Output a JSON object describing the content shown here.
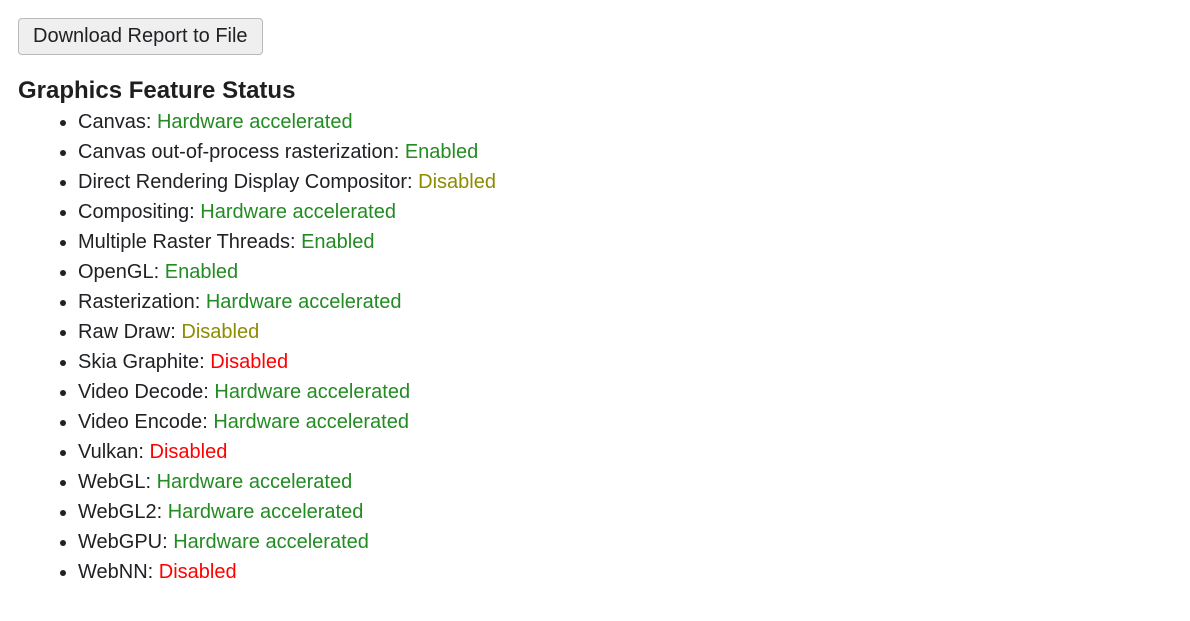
{
  "buttons": {
    "download_report": "Download Report to File"
  },
  "section_title": "Graphics Feature Status",
  "status_colors": {
    "green": "#228b22",
    "olive": "#8e8b00",
    "red": "#ff0000"
  },
  "features": [
    {
      "name": "Canvas",
      "status": "Hardware accelerated",
      "status_class": "green"
    },
    {
      "name": "Canvas out-of-process rasterization",
      "status": "Enabled",
      "status_class": "green"
    },
    {
      "name": "Direct Rendering Display Compositor",
      "status": "Disabled",
      "status_class": "olive"
    },
    {
      "name": "Compositing",
      "status": "Hardware accelerated",
      "status_class": "green"
    },
    {
      "name": "Multiple Raster Threads",
      "status": "Enabled",
      "status_class": "green"
    },
    {
      "name": "OpenGL",
      "status": "Enabled",
      "status_class": "green"
    },
    {
      "name": "Rasterization",
      "status": "Hardware accelerated",
      "status_class": "green"
    },
    {
      "name": "Raw Draw",
      "status": "Disabled",
      "status_class": "olive"
    },
    {
      "name": "Skia Graphite",
      "status": "Disabled",
      "status_class": "red"
    },
    {
      "name": "Video Decode",
      "status": "Hardware accelerated",
      "status_class": "green"
    },
    {
      "name": "Video Encode",
      "status": "Hardware accelerated",
      "status_class": "green"
    },
    {
      "name": "Vulkan",
      "status": "Disabled",
      "status_class": "red"
    },
    {
      "name": "WebGL",
      "status": "Hardware accelerated",
      "status_class": "green"
    },
    {
      "name": "WebGL2",
      "status": "Hardware accelerated",
      "status_class": "green"
    },
    {
      "name": "WebGPU",
      "status": "Hardware accelerated",
      "status_class": "green"
    },
    {
      "name": "WebNN",
      "status": "Disabled",
      "status_class": "red"
    }
  ]
}
